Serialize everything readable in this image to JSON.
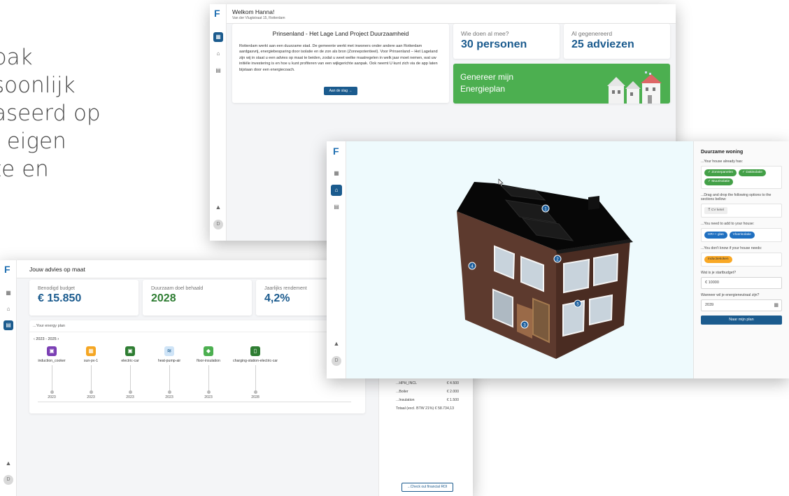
{
  "hero": {
    "lines": [
      "pak",
      "soonlijk",
      "aseerd op",
      ", eigen",
      "te en"
    ]
  },
  "brand": {
    "logo": "F",
    "accent": "#1b5b8e",
    "green": "#4caf50"
  },
  "dashboard": {
    "welcome": "Welkom Hanna!",
    "address": "Van der Vlugtstraat 15, Rotterdam",
    "project": {
      "title": "Prinsenland - Het Lage Land Project Duurzaamheid",
      "body": "Rotterdam werkt aan een duurzame stad. De gemeente werkt met inwoners onder andere aan Rotterdam aardgasvrij, energiebesparing door isolatie en de zon als bron (Zonnepotentieel). Voor Prinsenland – Het Lageland zijn wij in staat u een advies op maat te beiden, zodat u weet welke maatregelen in welk jaar moet nemen, wat uw initiële investering is en hoe u kunt profiteren van een wijkgerichte aanpak. Ook neemt U kunt zich via de app laten bijstaan door een energiecoach.",
      "button": "Aan de slag →"
    },
    "stats": [
      {
        "label": "Wie doen al mee?",
        "value": "30 personen"
      },
      {
        "label": "Al gegenereerd",
        "value": "25 adviezen"
      }
    ],
    "generate": {
      "line1": "Genereer mijn",
      "line2": "Energieplan"
    },
    "avatar": "D"
  },
  "advice": {
    "title": "Jouw advies op maat",
    "stats": [
      {
        "label": "Benodigd budget",
        "value": "€ 15.850"
      },
      {
        "label": "Duurzaam doel behaald",
        "value": "2028"
      },
      {
        "label": "Jaarlijks rendement",
        "value": "4,2%"
      }
    ],
    "plan_header": "...Your energy plan",
    "period_prev": "‹",
    "period": "2023 - 2025",
    "period_next": "›",
    "items": [
      {
        "name": "induction_cooker",
        "year": "2023",
        "color": "#7b3fb4",
        "glyph": "▣"
      },
      {
        "name": "sun-pv-1",
        "year": "2023",
        "color": "#f5a623",
        "glyph": "▦"
      },
      {
        "name": "electric-car",
        "year": "2023",
        "color": "#2e7d32",
        "glyph": "▣"
      },
      {
        "name": "heat-pump-air",
        "year": "2023",
        "color": "#cfe4f7",
        "glyph": "≋"
      },
      {
        "name": "floor-insulation",
        "year": "2023",
        "color": "#4caf50",
        "glyph": "◆"
      },
      {
        "name": "charging-station-electric-car",
        "year": "2028",
        "color": "#2e7d32",
        "glyph": "▯"
      }
    ],
    "costs": [
      {
        "label": "...HPH_INCL",
        "amount": "€ 4.500"
      },
      {
        "label": "...Boiler",
        "amount": "€ 2.000"
      },
      {
        "label": "...Insulation",
        "amount": "€ 1.500"
      }
    ],
    "total": "Totaal (excl. BTW 21%)  € 58.734,13",
    "roi_button": "...Check out financial ROI",
    "avatar": "D"
  },
  "house": {
    "panel_title": "Duurzame woning",
    "q_has": "...Your house already has:",
    "has": [
      "Zonnepanelen",
      "Dakisolatie",
      "Muurisolatie"
    ],
    "q_drag": "...Drag and drop the following options to the sections bellow:",
    "drag": [
      "CV ketel"
    ],
    "q_need": "...You need to add to your house:",
    "need": [
      "HR++ glas",
      "Vloerisolatie"
    ],
    "q_unknown": "...You don't know if your house needs:",
    "unknown": [
      "Inductiekoken"
    ],
    "q_budget": "Wat is je startbudget?",
    "budget": "€  10000",
    "q_year": "Wanneer wil je energieneutraal zijn?",
    "year": "2039",
    "button": "Naar mijn plan",
    "markers": [
      "1",
      "2",
      "3",
      "4",
      "5"
    ],
    "avatar": "D"
  }
}
